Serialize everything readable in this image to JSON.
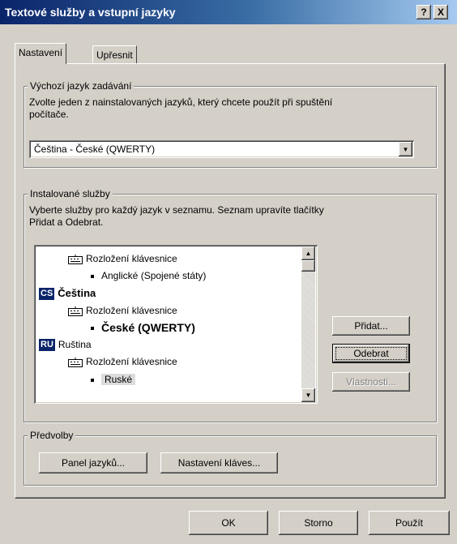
{
  "window": {
    "title": "Textové služby a vstupní jazyky",
    "help_button": "?",
    "close_button": "X"
  },
  "tabs": [
    {
      "label": "Nastavení"
    },
    {
      "label": "Upřesnit"
    }
  ],
  "default_language": {
    "legend": "Výchozí jazyk zadávání",
    "description_line1": "Zvolte jeden z nainstalovaných jazyků, který chcete použít při spuštění",
    "description_line2": "počítače.",
    "selected_value": "Čeština - České (QWERTY)"
  },
  "installed_services": {
    "legend": "Instalované služby",
    "description_line1": "Vyberte služby pro každý jazyk v seznamu. Seznam upravíte tlačítky",
    "description_line2": "Přidat a Odebrat.",
    "list": {
      "en_keyboard_label": "Rozložení klávesnice",
      "en_layout": "Anglické (Spojené státy)",
      "cs_badge": "CS",
      "cs_language": "Čeština",
      "cs_keyboard_label": "Rozložení klávesnice",
      "cs_layout": "České (QWERTY)",
      "ru_badge": "RU",
      "ru_language": "Ruština",
      "ru_keyboard_label": "Rozložení klávesnice",
      "ru_layout": "Ruské"
    },
    "buttons": {
      "add": "Přidat...",
      "remove": "Odebrat",
      "properties": "Vlastnosti..."
    }
  },
  "preferences": {
    "legend": "Předvolby",
    "language_bar_button": "Panel jazyků...",
    "key_settings_button": "Nastavení kláves..."
  },
  "footer": {
    "ok": "OK",
    "cancel": "Storno",
    "apply": "Použít"
  }
}
